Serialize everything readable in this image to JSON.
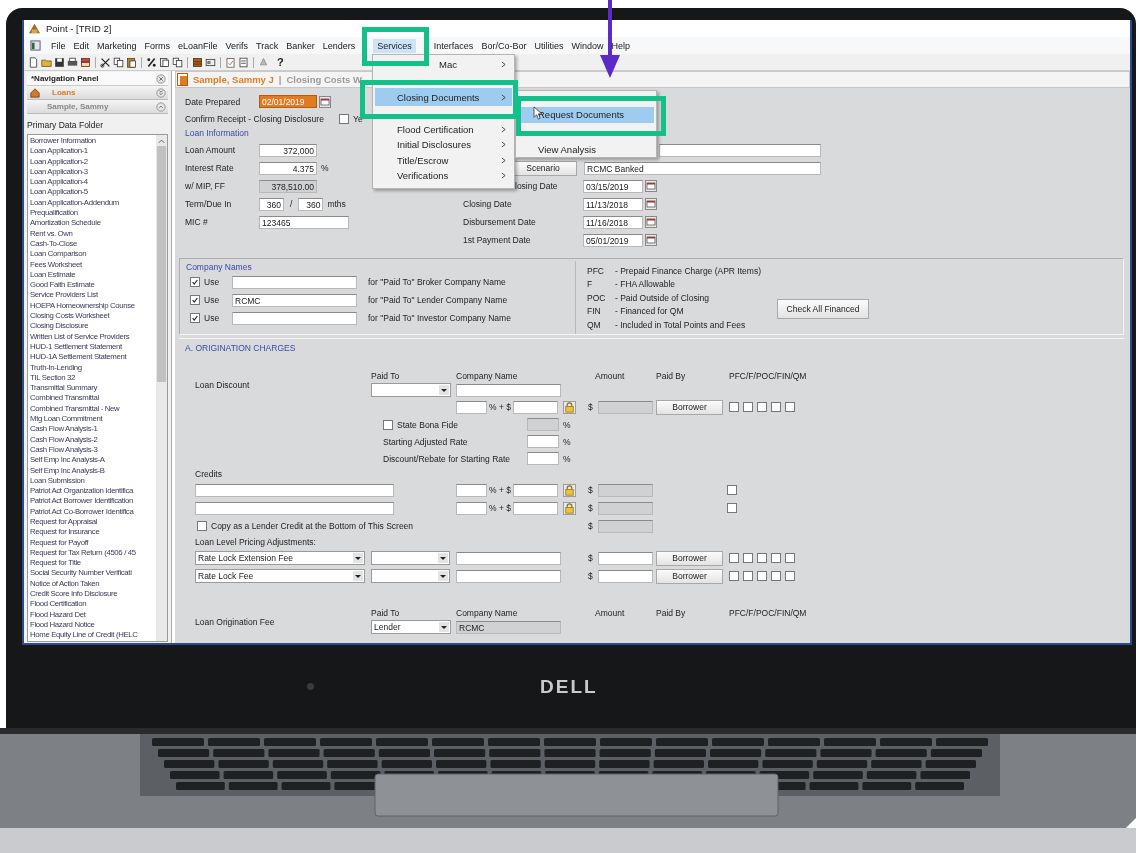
{
  "window": {
    "title": "Point - [TRID 2]"
  },
  "menu_bar": [
    {
      "label": "File",
      "selected": false
    },
    {
      "label": "Edit",
      "selected": false
    },
    {
      "label": "Marketing",
      "selected": false
    },
    {
      "label": "Forms",
      "selected": false
    },
    {
      "label": "eLoanFile",
      "selected": false
    },
    {
      "label": "Verifs",
      "selected": false
    },
    {
      "label": "Track",
      "selected": false
    },
    {
      "label": "Banker",
      "selected": false
    },
    {
      "label": "Lenders",
      "selected": false
    },
    {
      "label": "Services",
      "selected": true
    },
    {
      "label": "Interfaces",
      "selected": false
    },
    {
      "label": "Bor/Co-Bor",
      "selected": false
    },
    {
      "label": "Utilities",
      "selected": false
    },
    {
      "label": "Window",
      "selected": false
    },
    {
      "label": "Help",
      "selected": false
    }
  ],
  "toolbar": {
    "help": "?"
  },
  "services_menu": [
    {
      "label": "Mac",
      "selected": false,
      "submenu": true
    },
    {
      "label": "Closing Documents",
      "selected": true,
      "submenu": true
    },
    {
      "label": "Flood Certification",
      "selected": false,
      "submenu": true
    },
    {
      "label": "Initial Disclosures",
      "selected": false,
      "submenu": true
    },
    {
      "label": "Title/Escrow",
      "selected": false,
      "submenu": true
    },
    {
      "label": "Verifications",
      "selected": false,
      "submenu": true
    }
  ],
  "closing_documents_menu": [
    {
      "label": "Request Documents",
      "selected": true
    },
    {
      "label": "View Analysis",
      "selected": false
    }
  ],
  "navigation_panel": {
    "title": "*Navigation Panel",
    "loans": "Loans",
    "borrower": "Sample, Sammy",
    "folder_title": "Primary Data Folder",
    "items": [
      "Borrower Information",
      "Loan Application-1",
      "Loan Application-2",
      "Loan Application-3",
      "Loan Application-4",
      "Loan Application-5",
      "Loan Application-Addendum",
      "Prequalification",
      "Amortization Schedule",
      "Rent vs. Own",
      "Cash-To-Close",
      "Loan Comparison",
      "Fees Worksheet",
      "Loan Estimate",
      "Good Faith Estimate",
      "Service Providers List",
      "HOEPA Homeownership Counse",
      "Closing Costs Worksheet",
      "Closing Disclosure",
      "Written List of Service Providers",
      "HUD-1 Settlement Statement",
      "HUD-1A Settlement Statement",
      "Truth-In-Lending",
      "TIL Section 32",
      "Transmittal Summary",
      "Combined Transmittal",
      "Combined Transmittal - New",
      "Mtg Loan Commitment",
      "Cash Flow Analysis-1",
      "Cash Flow Analysis-2",
      "Cash Flow Analysis-3",
      "Self Emp Inc Analysis-A",
      "Self Emp Inc Analysis-B",
      "Loan Submission",
      "Patriot Act Organization Identifica",
      "Patriot Act Borrower Identification",
      "Patriot Act Co-Borrower Identifica",
      "Request for Appraisal",
      "Request for Insurance",
      "Request for Payoff",
      "Request for Tax Return (4506 / 45",
      "Request for Title",
      "Social Security Number Verificati",
      "Notice of Action Taken",
      "Credit Score Info Disclosure",
      "Flood Certification",
      "Flood Hazard Det",
      "Flood Hazard Notice",
      "Home Equity Line of Credit (HELC"
    ]
  },
  "form": {
    "header": {
      "borrower": "Sample, Sammy J",
      "separator": "|",
      "screen": "Closing Costs W"
    },
    "date_prepared": {
      "label": "Date Prepared",
      "value": "02/01/2019"
    },
    "confirm_receipt": {
      "label": "Confirm Receipt - Closing Disclosure",
      "option": "Ye",
      "checked": false
    },
    "loan_information": {
      "title": "Loan Information",
      "fields": [
        {
          "kind": "amount",
          "label": "Loan Amount",
          "value": "372,000"
        },
        {
          "kind": "amount",
          "label": "Interest Rate",
          "value": "4.375",
          "unit": "%"
        },
        {
          "kind": "readonly",
          "label": "w/ MIP, FF",
          "value": "378,510.00"
        },
        {
          "kind": "term",
          "label": "Term/Due In",
          "value": "360",
          "second_value": "360",
          "separator": "/",
          "unit": "mths"
        },
        {
          "kind": "text",
          "label": "MIC #",
          "value": "123465"
        }
      ],
      "scenario": {
        "button": "Scenario",
        "value": "RCMC Banked"
      },
      "dates": [
        {
          "label": "losing Date",
          "value": "03/15/2019"
        },
        {
          "label": "Closing Date",
          "value": "11/13/2018"
        },
        {
          "label": "Disbursement Date",
          "value": "11/16/2018"
        },
        {
          "label": "1st Payment Date",
          "value": "05/01/2019"
        }
      ]
    },
    "company_names": {
      "title": "Company Names",
      "rows": [
        {
          "checked": true,
          "label": "Use",
          "description": "for \"Paid To\" Broker Company Name"
        },
        {
          "checked": true,
          "label": "Use",
          "value": "RCMC",
          "description": "for \"Paid To\" Lender Company Name"
        },
        {
          "checked": true,
          "label": "Use",
          "description": "for \"Paid To\" Investor Company Name"
        }
      ],
      "legend": [
        {
          "code": "PFC",
          "text": "- Prepaid Finance Charge (APR Items)"
        },
        {
          "code": "F",
          "text": "- FHA Allowable"
        },
        {
          "code": "POC",
          "text": "- Paid Outside of Closing"
        },
        {
          "code": "FIN",
          "text": "- Financed for QM"
        },
        {
          "code": "QM",
          "text": "- Included in Total Points and Fees"
        }
      ],
      "button": "Check All Financed"
    },
    "origination_charges": {
      "title": "A. ORIGINATION CHARGES",
      "rows": [
        {
          "kind": "header",
          "paid_to": "Paid To",
          "company": "Company Name",
          "amount": "Amount",
          "paid_by": "Paid By",
          "flags": "PFC/F/POC/FIN/QM"
        },
        {
          "kind": "select",
          "label": "Loan Discount"
        },
        {
          "kind": "amount",
          "percent_plus": "% + $",
          "currency": "$",
          "paid_by": "Borrower",
          "flags": [
            {
              "checked": false
            },
            {
              "checked": false
            },
            {
              "checked": false
            },
            {
              "checked": false
            },
            {
              "checked": false
            }
          ]
        },
        {
          "kind": "check_rate",
          "label": "State Bona Fide",
          "checked": false,
          "unit": "%"
        },
        {
          "kind": "rate",
          "label": "Starting Adjusted Rate",
          "unit": "%"
        },
        {
          "kind": "rate",
          "label": "Discount/Rebate for Starting Rate",
          "unit": "%"
        },
        {
          "kind": "caption",
          "label": "Credits"
        },
        {
          "kind": "credit",
          "percent_plus": "% + $",
          "currency": "$",
          "checked": false
        },
        {
          "kind": "credit",
          "percent_plus": "% + $",
          "currency": "$",
          "checked": false
        },
        {
          "kind": "copy",
          "label": "Copy as a Lender Credit at the Bottom of This Screen",
          "checked": false,
          "currency": "$"
        },
        {
          "kind": "caption",
          "label": "Loan Level Pricing Adjustments:"
        },
        {
          "kind": "llpa",
          "fee": "Rate Lock Extension Fee",
          "currency": "$",
          "paid_by": "Borrower",
          "flags": [
            {
              "checked": false
            },
            {
              "checked": false
            },
            {
              "checked": false
            },
            {
              "checked": false
            },
            {
              "checked": false
            }
          ]
        },
        {
          "kind": "llpa",
          "fee": "Rate Lock Fee",
          "currency": "$",
          "paid_by": "Borrower",
          "flags": [
            {
              "checked": false
            },
            {
              "checked": false
            },
            {
              "checked": false
            },
            {
              "checked": false
            },
            {
              "checked": false
            }
          ]
        },
        {
          "kind": "header",
          "paid_to": "Paid To",
          "company": "Company Name",
          "amount": "Amount",
          "paid_by": "Paid By",
          "flags": "PFC/F/POC/FIN/QM"
        },
        {
          "kind": "select",
          "label": "Loan Origination Fee",
          "paid_to": "Lender",
          "company": "RCMC"
        }
      ]
    }
  },
  "laptop": {
    "logo": "DELL"
  }
}
